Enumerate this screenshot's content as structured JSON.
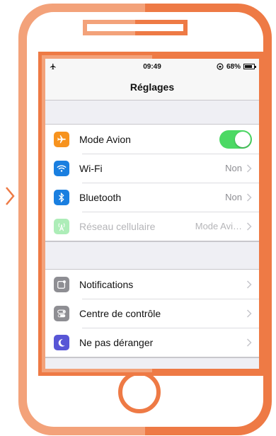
{
  "status_bar": {
    "time": "09:49",
    "battery": "68%"
  },
  "nav": {
    "title": "Réglages"
  },
  "group1": [
    {
      "label": "Mode Avion",
      "value": "",
      "icon": "airplane-icon",
      "color": "#f7931e",
      "toggle": true
    },
    {
      "label": "Wi-Fi",
      "value": "Non",
      "icon": "wifi-icon",
      "color": "#1a7fe0"
    },
    {
      "label": "Bluetooth",
      "value": "Non",
      "icon": "bluetooth-icon",
      "color": "#1a7fe0"
    },
    {
      "label": "Réseau cellulaire",
      "value": "Mode Avi…",
      "icon": "cellular-icon",
      "color": "#4cd964",
      "disabled": true
    }
  ],
  "group2": [
    {
      "label": "Notifications",
      "value": "",
      "icon": "notifications-icon",
      "color": "#8e8e93"
    },
    {
      "label": "Centre de contrôle",
      "value": "",
      "icon": "control-center-icon",
      "color": "#8e8e93"
    },
    {
      "label": "Ne pas déranger",
      "value": "",
      "icon": "moon-icon",
      "color": "#5856d6"
    }
  ],
  "colors": {
    "accent": "#ee7a45",
    "accent_light": "#f3a27a",
    "toggle_on": "#4cd964"
  }
}
